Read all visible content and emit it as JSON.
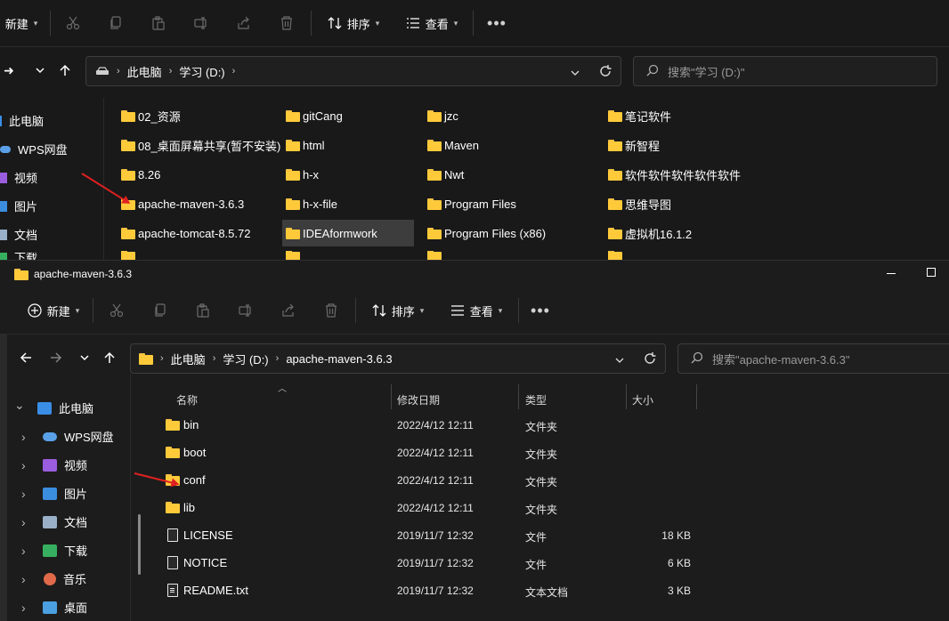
{
  "back_window": {
    "toolbar": {
      "new_label": "新建",
      "sort_label": "排序",
      "view_label": "查看"
    },
    "address": {
      "drive_icon": "drive-icon",
      "crumbs": [
        "此电脑",
        "学习 (D:)"
      ]
    },
    "search_placeholder": "搜索\"学习 (D:)\"",
    "sidebar": [
      "此电脑",
      "WPS网盘",
      "视频",
      "图片",
      "文档",
      "下载"
    ],
    "folders": [
      [
        "02_资源",
        "08_桌面屏幕共享(暂不安装)",
        "8.26",
        "apache-maven-3.6.3",
        "apache-tomcat-8.5.72"
      ],
      [
        "gitCang",
        "html",
        "h-x",
        "h-x-file",
        "IDEAformwork"
      ],
      [
        "jzc",
        "Maven",
        "Nwt",
        "Program Files",
        "Program Files (x86)"
      ],
      [
        "笔记软件",
        "新智程",
        "软件软件软件软件软件",
        "思维导图",
        "虚拟机16.1.2"
      ]
    ],
    "selected_folder": "IDEAformwork"
  },
  "front_window": {
    "title": "apache-maven-3.6.3",
    "toolbar": {
      "new_label": "新建",
      "sort_label": "排序",
      "view_label": "查看"
    },
    "address": {
      "crumbs": [
        "此电脑",
        "学习 (D:)",
        "apache-maven-3.6.3"
      ]
    },
    "search_placeholder": "搜索\"apache-maven-3.6.3\"",
    "sidebar": [
      "此电脑",
      "WPS网盘",
      "视频",
      "图片",
      "文档",
      "下载",
      "音乐",
      "桌面"
    ],
    "columns": [
      "名称",
      "修改日期",
      "类型",
      "大小"
    ],
    "rows": [
      {
        "name": "bin",
        "date": "2022/4/12 12:11",
        "type": "文件夹",
        "size": "",
        "kind": "folder"
      },
      {
        "name": "boot",
        "date": "2022/4/12 12:11",
        "type": "文件夹",
        "size": "",
        "kind": "folder"
      },
      {
        "name": "conf",
        "date": "2022/4/12 12:11",
        "type": "文件夹",
        "size": "",
        "kind": "folder"
      },
      {
        "name": "lib",
        "date": "2022/4/12 12:11",
        "type": "文件夹",
        "size": "",
        "kind": "folder"
      },
      {
        "name": "LICENSE",
        "date": "2019/11/7 12:32",
        "type": "文件",
        "size": "18 KB",
        "kind": "file"
      },
      {
        "name": "NOTICE",
        "date": "2019/11/7 12:32",
        "type": "文件",
        "size": "6 KB",
        "kind": "file"
      },
      {
        "name": "README.txt",
        "date": "2019/11/7 12:32",
        "type": "文本文档",
        "size": "3 KB",
        "kind": "txt"
      }
    ]
  },
  "colors": {
    "folder": "#ffca3a",
    "annotation_arrow": "#e02020",
    "selection": "#3d3d3d"
  }
}
